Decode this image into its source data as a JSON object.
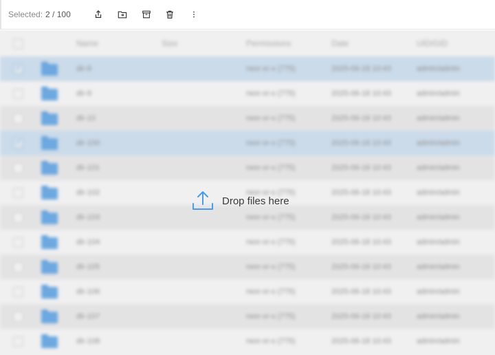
{
  "toolbar": {
    "selected_label": "Selected:",
    "selected_value": "2 / 100",
    "actions": [
      {
        "name": "share-icon"
      },
      {
        "name": "move-to-folder-icon"
      },
      {
        "name": "archive-icon"
      },
      {
        "name": "delete-icon"
      },
      {
        "name": "more-options-icon"
      }
    ]
  },
  "table": {
    "columns": [
      "Name",
      "Size",
      "Permissions",
      "Date",
      "UID/GID"
    ],
    "rows": [
      {
        "name": "dir-8",
        "size": "",
        "permissions": "rwxr-xr-x (775)",
        "date": "2025-06-18 10:43",
        "owner": "admin/admin",
        "selected": true
      },
      {
        "name": "dir-9",
        "size": "",
        "permissions": "rwxr-xr-x (775)",
        "date": "2025-06-18 10:43",
        "owner": "admin/admin",
        "selected": false
      },
      {
        "name": "dir-10",
        "size": "",
        "permissions": "rwxr-xr-x (775)",
        "date": "2025-06-18 10:43",
        "owner": "admin/admin",
        "selected": false
      },
      {
        "name": "dir-100",
        "size": "",
        "permissions": "rwxr-xr-x (775)",
        "date": "2025-06-18 10:43",
        "owner": "admin/admin",
        "selected": true
      },
      {
        "name": "dir-101",
        "size": "",
        "permissions": "rwxr-xr-x (775)",
        "date": "2025-06-18 10:43",
        "owner": "admin/admin",
        "selected": false
      },
      {
        "name": "dir-102",
        "size": "",
        "permissions": "rwxr-xr-x (775)",
        "date": "2025-06-18 10:43",
        "owner": "admin/admin",
        "selected": false
      },
      {
        "name": "dir-103",
        "size": "",
        "permissions": "rwxr-xr-x (775)",
        "date": "2025-06-18 10:43",
        "owner": "admin/admin",
        "selected": false
      },
      {
        "name": "dir-104",
        "size": "",
        "permissions": "rwxr-xr-x (775)",
        "date": "2025-06-18 10:43",
        "owner": "admin/admin",
        "selected": false
      },
      {
        "name": "dir-105",
        "size": "",
        "permissions": "rwxr-xr-x (775)",
        "date": "2025-06-18 10:43",
        "owner": "admin/admin",
        "selected": false
      },
      {
        "name": "dir-106",
        "size": "",
        "permissions": "rwxr-xr-x (775)",
        "date": "2025-06-18 10:43",
        "owner": "admin/admin",
        "selected": false
      },
      {
        "name": "dir-107",
        "size": "",
        "permissions": "rwxr-xr-x (775)",
        "date": "2025-06-18 10:43",
        "owner": "admin/admin",
        "selected": false
      },
      {
        "name": "dir-108",
        "size": "",
        "permissions": "rwxr-xr-x (775)",
        "date": "2025-06-18 10:43",
        "owner": "admin/admin",
        "selected": false
      }
    ]
  },
  "drop_zone": {
    "icon": "upload-icon",
    "text": "Drop files here",
    "accent": "#4a9be8"
  }
}
